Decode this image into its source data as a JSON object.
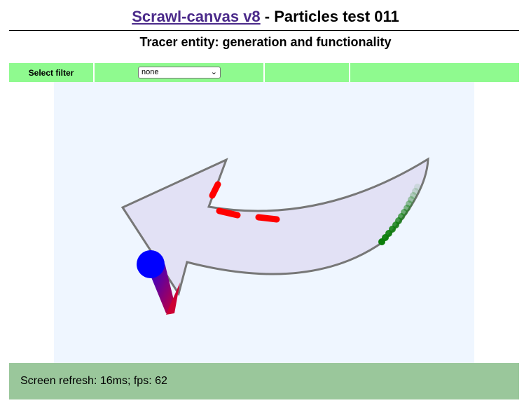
{
  "header": {
    "title_link": "Scrawl-canvas v8",
    "title_rest": " - Particles test 011",
    "subtitle": "Tracer entity: generation and functionality"
  },
  "controls": {
    "filter_label": "Select filter",
    "filter_value": "none"
  },
  "canvas": {
    "background": "#eff6ff",
    "arrow_fill": "#e2e1f5",
    "arrow_stroke": "#777777",
    "tracers": {
      "red": "#ff0000",
      "green": "#0a7d0a",
      "gradient_start": "#0000ff",
      "gradient_end": "#cc0033"
    }
  },
  "status": {
    "text": "Screen refresh: 16ms; fps: 62"
  },
  "colors": {
    "control_bar": "#8ffa8f",
    "status_bar": "#9ac79b",
    "link": "#4b2a8a"
  }
}
